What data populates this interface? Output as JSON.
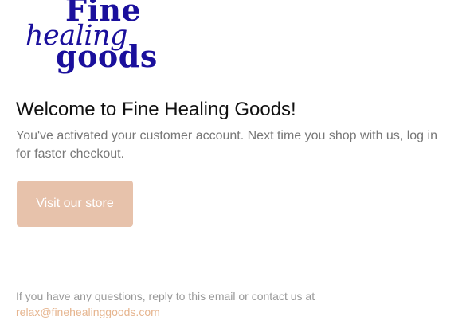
{
  "logo": {
    "line1": "Fine",
    "line2": "healing",
    "line3": "goods",
    "color": "#1a0f9c"
  },
  "heading": "Welcome to Fine Healing Goods!",
  "message": "You've activated your customer account. Next time you shop with us, log in for faster checkout.",
  "button": {
    "label": "Visit our store",
    "color": "#e7c2ab"
  },
  "footer": {
    "text": "If you have any questions, reply to this email or contact us at",
    "email": "relax@finehealinggoods.com",
    "link_color": "#e6b58f"
  }
}
